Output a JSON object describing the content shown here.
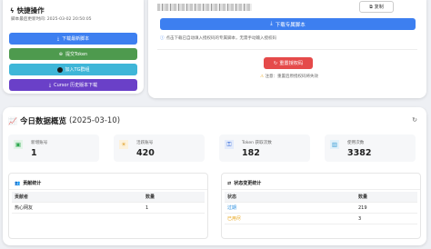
{
  "quick_actions": {
    "title": "快捷操作",
    "last_updated": "脚本最后更新时间: 2025-03-02 20:50:05",
    "buttons": [
      {
        "label": "下载最新脚本",
        "color": "#3d7ff0",
        "icon": "download-icon"
      },
      {
        "label": "提交Token",
        "color": "#4e9a4e",
        "icon": "plus-icon"
      },
      {
        "label": "加入TG群组",
        "color": "#3fb6d8",
        "icon": "telegram-icon"
      },
      {
        "label": "Cursor 历史版本下载",
        "color": "#6a40c8",
        "icon": "download-icon"
      }
    ]
  },
  "exclusive": {
    "copy_label": "复制",
    "download_label": "下载专属脚本",
    "hint": "点击下载已自动填入授权码的专属脚本，无需手动输入授权码",
    "reset_label": "重置授权码",
    "note": "注意：重置后原授权码将失效"
  },
  "today": {
    "title": "今日数据概览",
    "date": "(2025-03-10)",
    "stats": [
      {
        "label": "新增账号",
        "value": "1",
        "icon": "user-plus-icon",
        "color": "#2ea84f",
        "bg": "#e3f4e8"
      },
      {
        "label": "活跃账号",
        "value": "420",
        "icon": "sun-icon",
        "color": "#e0a22e",
        "bg": "#fdf2dc"
      },
      {
        "label": "Token 获取次数",
        "value": "182",
        "icon": "key-icon",
        "color": "#3d6fd8",
        "bg": "#e3ebfb"
      },
      {
        "label": "使用次数",
        "value": "3382",
        "icon": "chart-icon",
        "color": "#3a9dd6",
        "bg": "#e1f1fa"
      }
    ]
  },
  "contributions": {
    "title": "贡献统计",
    "headers": [
      "贡献者",
      "数量"
    ],
    "rows": [
      [
        "热心网友",
        "1"
      ]
    ]
  },
  "status_changes": {
    "title": "状态变更统计",
    "headers": [
      "状态",
      "数量"
    ],
    "rows": [
      {
        "status": "过期",
        "count": "219",
        "color": "#2b8fe0"
      },
      {
        "status": "已用尽",
        "count": "3",
        "color": "#e8a417"
      }
    ]
  }
}
